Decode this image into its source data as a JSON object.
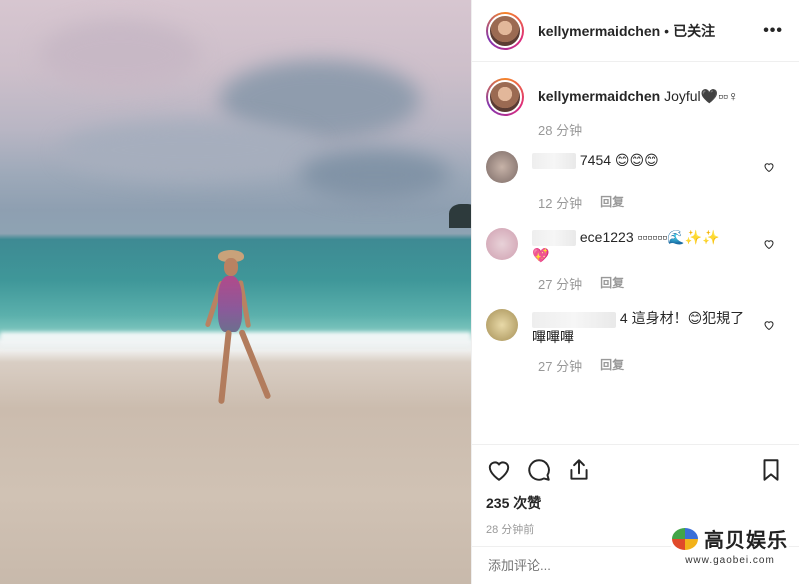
{
  "header": {
    "username": "kellymermaidchen",
    "separator": "•",
    "follow_status": "已关注",
    "more_label": "•••"
  },
  "caption": {
    "username": "kellymermaidchen",
    "text": "Joyful🖤▫▫♀",
    "time": "28 分钟"
  },
  "comments": [
    {
      "text": "7454 😊😊😊",
      "time": "12 分钟",
      "reply": "回复"
    },
    {
      "text": "ece1223 ▫▫▫▫▫▫🌊✨✨",
      "text2": "💖",
      "time": "27 分钟",
      "reply": "回复"
    },
    {
      "text": "4 這身材！😊犯規了",
      "text2": "嗶嗶嗶",
      "time": "27 分钟",
      "reply": "回复"
    }
  ],
  "actions": {
    "like_icon": "heart-icon",
    "comment_icon": "comment-icon",
    "share_icon": "share-icon",
    "save_icon": "bookmark-icon",
    "likes": "235 次赞",
    "posted": "28 分钟前"
  },
  "add_comment": {
    "placeholder": "添加评论..."
  },
  "watermark": {
    "title": "高贝娱乐",
    "url": "www.gaobei.com"
  }
}
